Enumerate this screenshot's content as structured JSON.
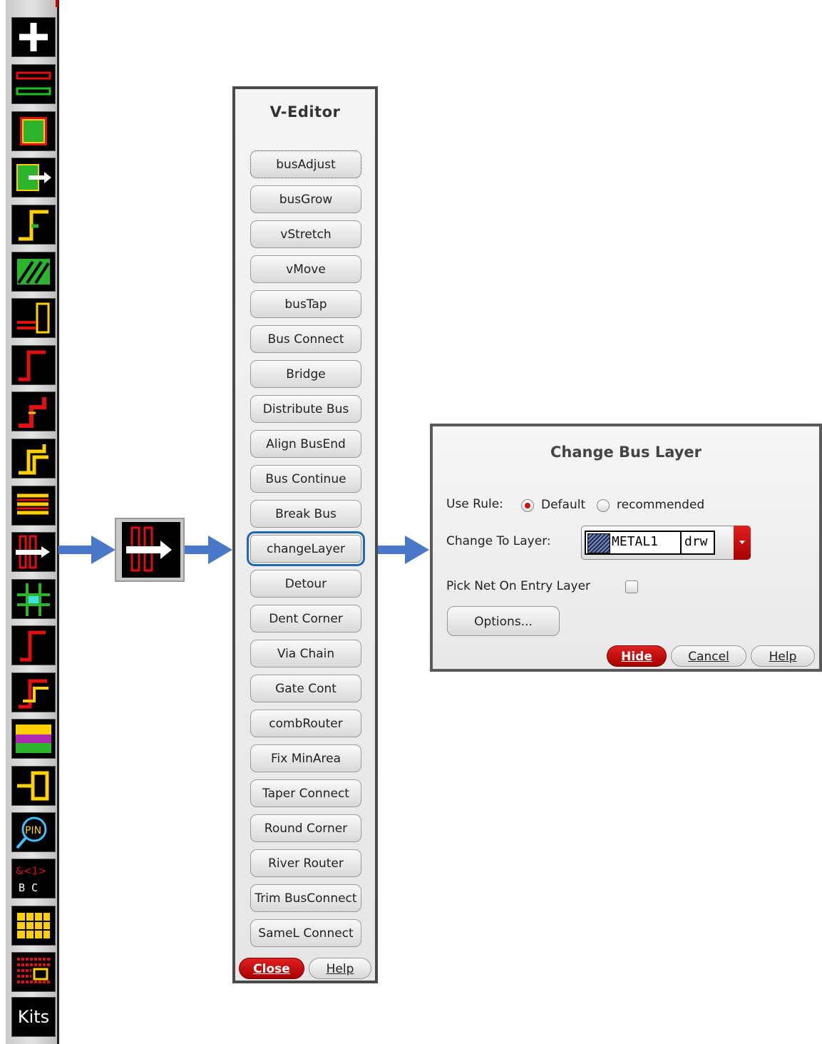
{
  "toolbar": {
    "tools": [
      "add-icon",
      "bus-lines-icon",
      "hatched-rect-icon",
      "bus-move-icon",
      "step-wire-icon",
      "diagonal-hatch-icon",
      "bus-tap-icon",
      "corner-wire-icon",
      "jog-wire-icon",
      "double-jog-icon",
      "distribute-bus-icon",
      "change-layer-icon",
      "cross-grid-icon",
      "corner-wire-2-icon",
      "jog-wire-2-icon",
      "router-pattern-icon",
      "connect-icon",
      "pin-search-icon",
      "bus-label-icon",
      "grid-pattern-icon",
      "array-pattern-icon",
      "kits-icon"
    ],
    "kits_label": "Kits"
  },
  "veditor": {
    "title": "V-Editor",
    "buttons": [
      "busAdjust",
      "busGrow",
      "vStretch",
      "vMove",
      "busTap",
      "Bus Connect",
      "Bridge",
      "Distribute Bus",
      "Align BusEnd",
      "Bus Continue",
      "Break Bus",
      "changeLayer",
      "Detour",
      "Dent Corner",
      "Via Chain",
      "Gate Cont",
      "combRouter",
      "Fix MinArea",
      "Taper Connect",
      "Round Corner",
      "River Router",
      "Trim BusConnect",
      "SameL Connect"
    ],
    "close_label": "Close",
    "help_label": "Help"
  },
  "dialog": {
    "title": "Change Bus Layer",
    "use_rule_label": "Use Rule:",
    "rule_default": "Default",
    "rule_recommended": "recommended",
    "change_to_layer_label": "Change To Layer:",
    "layer_name": "METAL1",
    "layer_purpose": "drw",
    "pick_net_label": "Pick Net On Entry Layer",
    "options_label": "Options...",
    "hide_label": "Hide",
    "cancel_label": "Cancel",
    "help_label": "Help"
  },
  "colors": {
    "accent_red": "#c00000",
    "highlight_blue": "#1f67b3",
    "arrow_blue": "#4a78c8"
  }
}
